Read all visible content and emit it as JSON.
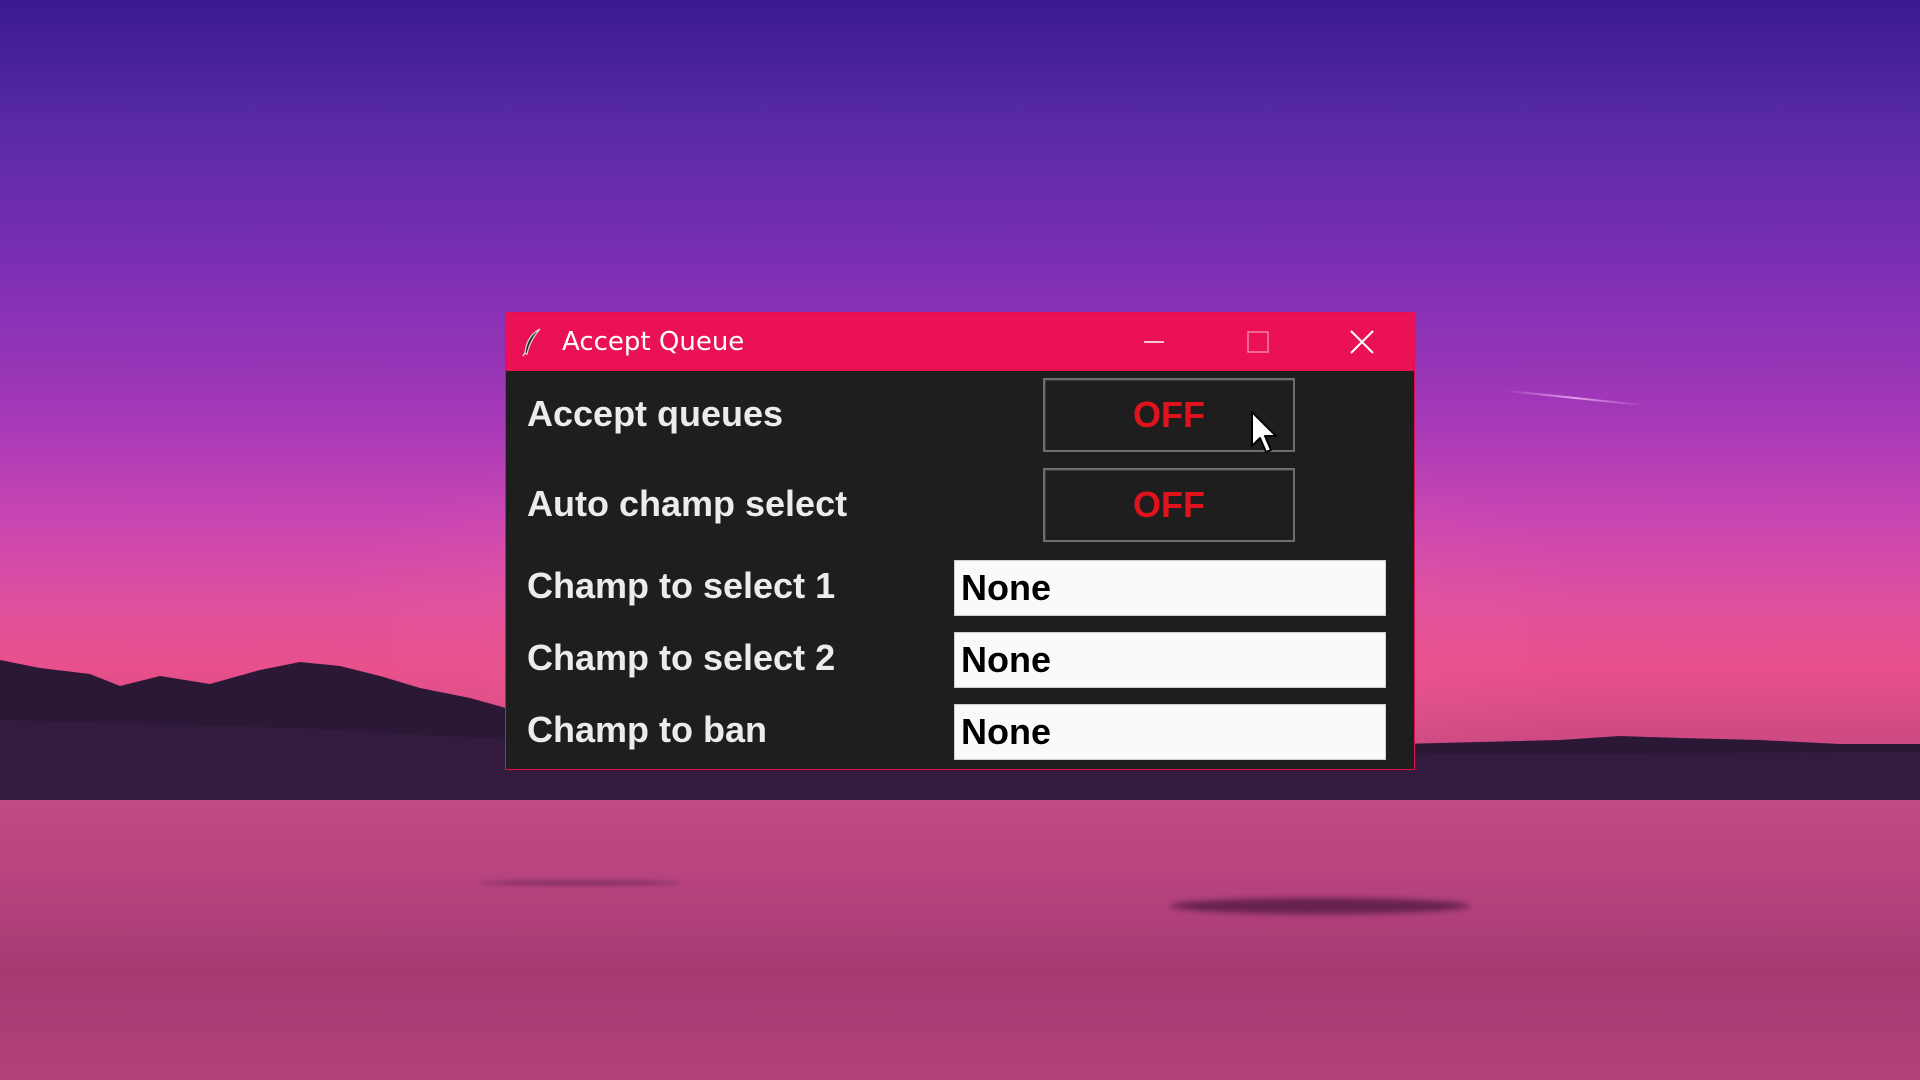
{
  "window": {
    "title": "Accept Queue",
    "title_bar_color": "#ea1155",
    "background_color": "#1e1e1e"
  },
  "title_bar_icons": {
    "app_icon": "feather-icon",
    "minimize": "minimize-icon",
    "maximize": "maximize-icon",
    "close": "close-icon"
  },
  "rows": {
    "accept_queues": {
      "label": "Accept queues",
      "button_label": "OFF"
    },
    "auto_champ_select": {
      "label": "Auto champ select",
      "button_label": "OFF"
    },
    "champ_select_1": {
      "label": "Champ to select 1",
      "value": "None"
    },
    "champ_select_2": {
      "label": "Champ to select 2",
      "value": "None"
    },
    "champ_ban": {
      "label": "Champ to ban",
      "value": "None"
    }
  },
  "colors": {
    "off_text": "#e0121c",
    "label_text": "#ececec"
  }
}
